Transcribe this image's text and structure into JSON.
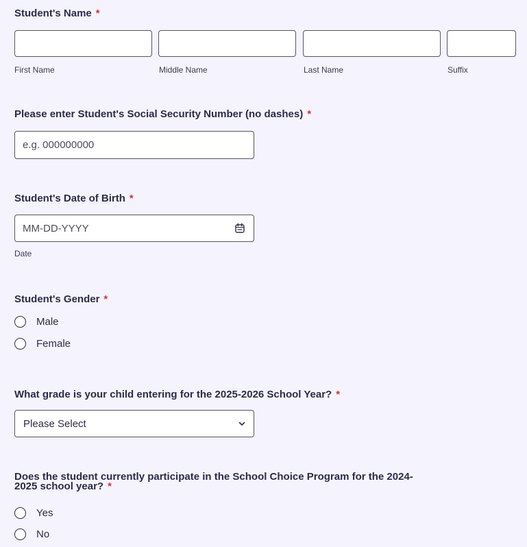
{
  "student_name": {
    "label": "Student's Name",
    "required_mark": "*",
    "fields": [
      {
        "sublabel": "First Name",
        "value": ""
      },
      {
        "sublabel": "Middle Name",
        "value": ""
      },
      {
        "sublabel": "Last Name",
        "value": ""
      },
      {
        "sublabel": "Suffix",
        "value": ""
      }
    ]
  },
  "ssn": {
    "label": "Please enter Student's Social Security Number (no dashes)",
    "required_mark": "*",
    "placeholder": "e.g. 000000000",
    "value": ""
  },
  "dob": {
    "label": "Student's Date of Birth",
    "required_mark": "*",
    "placeholder": "MM-DD-YYYY",
    "sublabel": "Date",
    "icon": "calendar-icon"
  },
  "gender": {
    "label": "Student's Gender",
    "required_mark": "*",
    "options": [
      "Male",
      "Female"
    ]
  },
  "grade": {
    "label": "What grade is your child entering for the 2025-2026 School Year?",
    "required_mark": "*",
    "selected": "Please Select",
    "icon": "chevron-down-icon"
  },
  "school_choice": {
    "label_line1": "Does the student currently participate in the School Choice Program for the 2024-",
    "label_line2": "2025 school year?",
    "required_mark": "*",
    "options": [
      "Yes",
      "No"
    ]
  },
  "colors": {
    "background": "#f5f3fd",
    "text": "#2c2c46",
    "required": "#e0312b",
    "border": "#55555c"
  }
}
